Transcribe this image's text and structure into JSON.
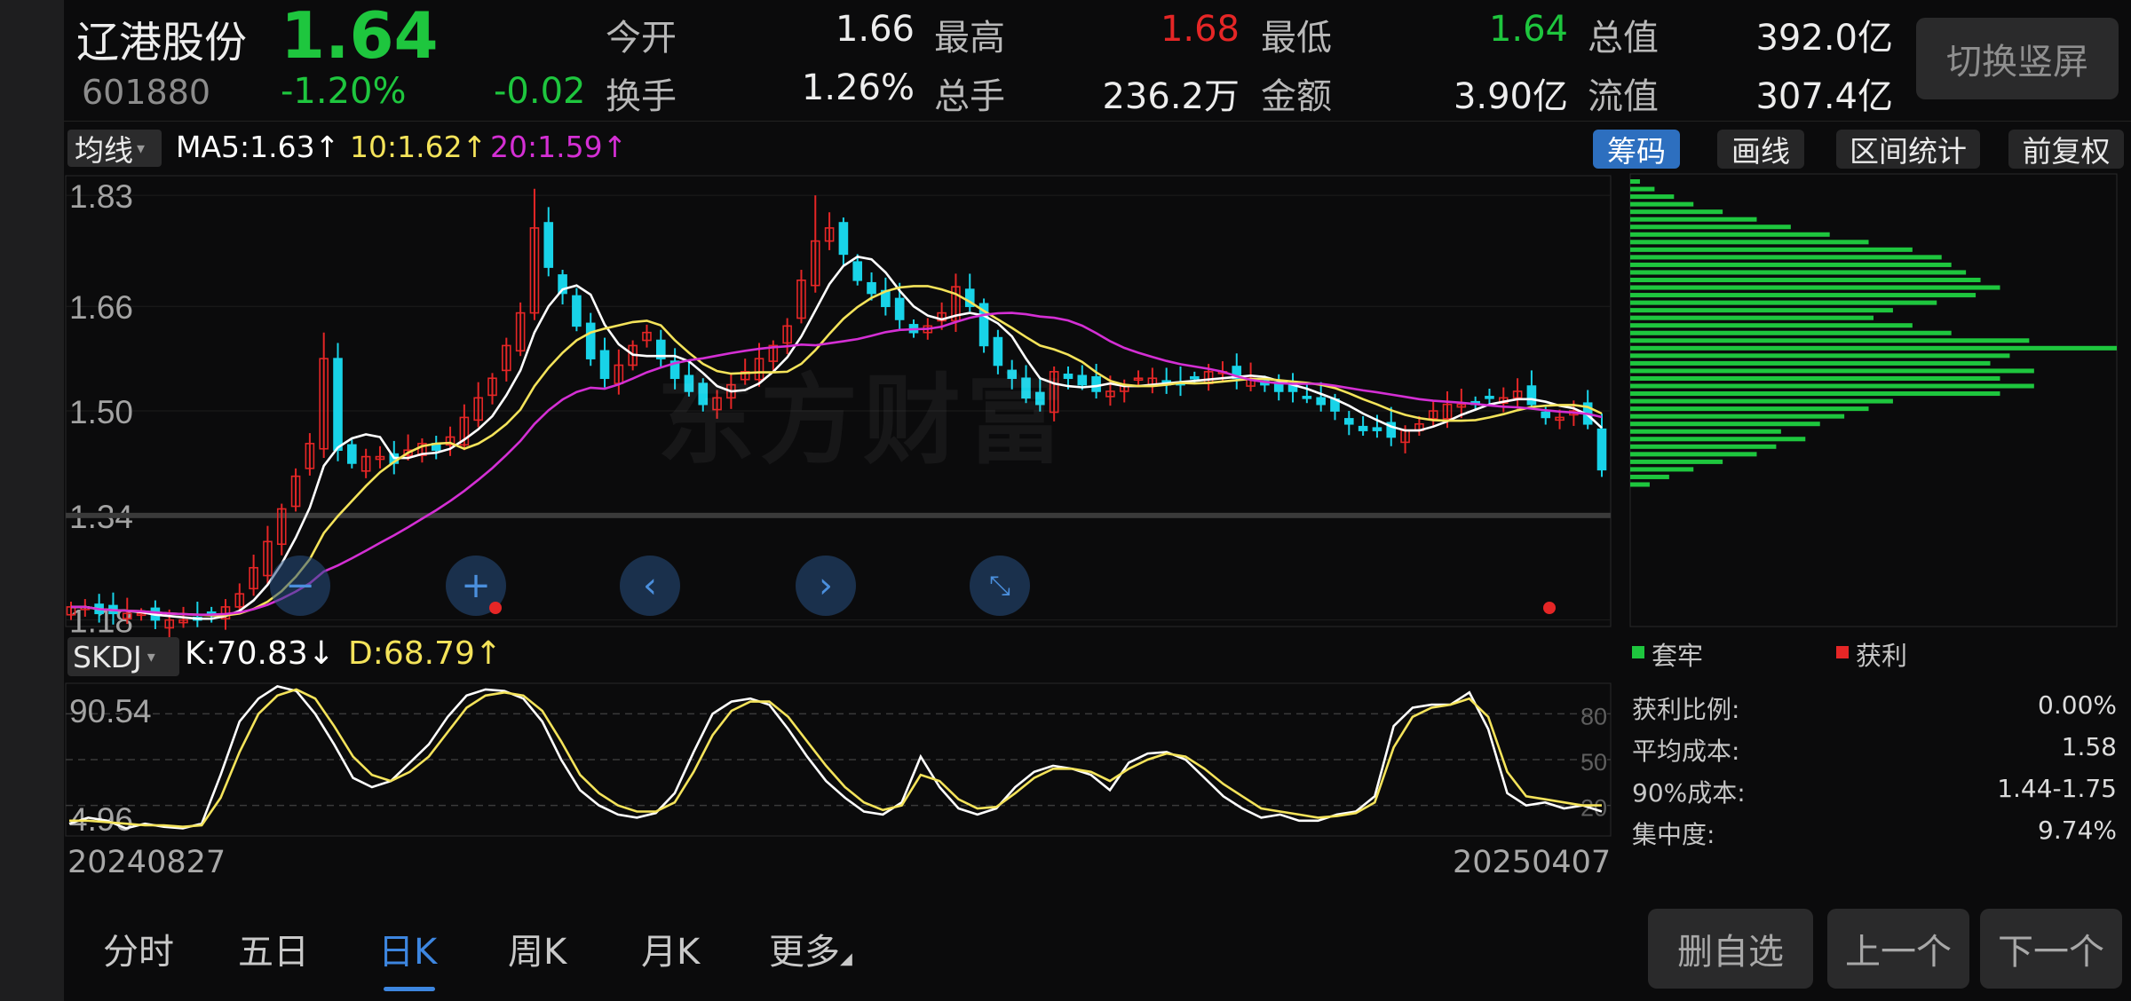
{
  "header": {
    "stock_name": "辽港股份",
    "price": "1.64",
    "code": "601880",
    "change_pct": "-1.20%",
    "change": "-0.02",
    "switch_label": "切换竖屏",
    "quotes": [
      {
        "label": "今开",
        "value": "1.66",
        "color": "#ededed"
      },
      {
        "label": "最高",
        "value": "1.68",
        "color": "#e52626"
      },
      {
        "label": "最低",
        "value": "1.64",
        "color": "#1ec63e"
      },
      {
        "label": "总值",
        "value": "392.0亿",
        "color": "#ededed"
      },
      {
        "label": "换手",
        "value": "1.26%",
        "color": "#ededed"
      },
      {
        "label": "总手",
        "value": "236.2万",
        "color": "#ededed"
      },
      {
        "label": "金额",
        "value": "3.90亿",
        "color": "#ededed"
      },
      {
        "label": "流值",
        "value": "307.4亿",
        "color": "#ededed"
      }
    ]
  },
  "toolbar": {
    "ma_selector": "均线",
    "ma5": "MA5:1.63↑",
    "ma10": "10:1.62↑",
    "ma20": "20:1.59↑",
    "buttons": [
      "筹码",
      "画线",
      "区间统计",
      "前复权"
    ]
  },
  "colors": {
    "up": "#e52626",
    "down": "#18d3e8",
    "ma5": "#ffffff",
    "ma10": "#f4e35a",
    "ma20": "#d42fd4",
    "chip": "#1ec63e",
    "kline": "#ffffff",
    "dline": "#f4e35a"
  },
  "watermark": "东方财富",
  "indicator": {
    "selector": "SKDJ",
    "k": "K:70.83↓",
    "d": "D:68.79↑"
  },
  "dates": {
    "start": "20240827",
    "end": "20250407"
  },
  "chips": {
    "legend_loss": "套牢",
    "legend_profit": "获利",
    "stats": [
      {
        "label": "获利比例:",
        "value": "0.00%"
      },
      {
        "label": "平均成本:",
        "value": "1.58"
      },
      {
        "label": "90%成本:",
        "value": "1.44-1.75"
      },
      {
        "label": "集中度:",
        "value": "9.74%"
      }
    ]
  },
  "tabs": [
    "分时",
    "五日",
    "日K",
    "周K",
    "月K",
    "更多"
  ],
  "active_tab": "日K",
  "bottom_buttons": [
    "删自选",
    "上一个",
    "下一个"
  ],
  "chart_data": [
    {
      "type": "candlestick",
      "y_ticks": [
        "1.83",
        "1.66",
        "1.50",
        "1.34",
        "1.18"
      ],
      "ylim": [
        1.17,
        1.86
      ],
      "x_range": [
        "20240827",
        "20250407"
      ],
      "series_ma": [
        {
          "name": "MA5",
          "last": 1.63
        },
        {
          "name": "MA10",
          "last": 1.62
        },
        {
          "name": "MA20",
          "last": 1.59
        }
      ],
      "close_path": [
        1.2,
        1.2,
        1.19,
        1.19,
        1.19,
        1.19,
        1.18,
        1.18,
        1.18,
        1.18,
        1.19,
        1.2,
        1.22,
        1.26,
        1.3,
        1.35,
        1.4,
        1.45,
        1.58,
        1.44,
        1.42,
        1.43,
        1.43,
        1.42,
        1.44,
        1.45,
        1.44,
        1.46,
        1.49,
        1.52,
        1.55,
        1.6,
        1.65,
        1.78,
        1.72,
        1.68,
        1.63,
        1.58,
        1.55,
        1.57,
        1.6,
        1.62,
        1.58,
        1.55,
        1.53,
        1.51,
        1.52,
        1.54,
        1.56,
        1.58,
        1.6,
        1.63,
        1.7,
        1.76,
        1.78,
        1.74,
        1.7,
        1.68,
        1.66,
        1.64,
        1.62,
        1.63,
        1.65,
        1.69,
        1.66,
        1.6,
        1.57,
        1.55,
        1.52,
        1.51,
        1.56,
        1.55,
        1.54,
        1.53,
        1.53,
        1.54,
        1.55,
        1.55,
        1.54,
        1.54,
        1.55,
        1.56,
        1.56,
        1.55,
        1.55,
        1.54,
        1.53,
        1.53,
        1.52,
        1.51,
        1.5,
        1.48,
        1.47,
        1.47,
        1.46,
        1.47,
        1.48,
        1.5,
        1.51,
        1.51,
        1.51,
        1.52,
        1.52,
        1.53,
        1.51,
        1.49,
        1.49,
        1.5,
        1.48,
        1.41
      ]
    },
    {
      "type": "line",
      "title": "SKDJ",
      "y_ticks": [
        "90.54",
        "4.96"
      ],
      "right_ticks": [
        "80",
        "50",
        "20"
      ],
      "ylim": [
        0,
        100
      ],
      "series": [
        {
          "name": "K",
          "values": [
            8,
            12,
            10,
            5,
            8,
            6,
            5,
            8,
            40,
            75,
            90,
            98,
            95,
            80,
            60,
            38,
            32,
            36,
            48,
            60,
            78,
            92,
            96,
            95,
            90,
            75,
            50,
            30,
            20,
            14,
            12,
            15,
            28,
            55,
            80,
            88,
            90,
            86,
            70,
            52,
            36,
            25,
            16,
            14,
            22,
            52,
            32,
            18,
            14,
            18,
            32,
            42,
            46,
            44,
            40,
            30,
            48,
            54,
            55,
            50,
            38,
            26,
            18,
            12,
            14,
            10,
            10,
            14,
            16,
            26,
            72,
            84,
            86,
            86,
            94,
            70,
            28,
            20,
            22,
            18,
            20,
            16
          ]
        },
        {
          "name": "D",
          "values": [
            10,
            10,
            9,
            8,
            7,
            7,
            6,
            7,
            25,
            55,
            80,
            92,
            96,
            90,
            72,
            52,
            40,
            36,
            42,
            52,
            68,
            84,
            92,
            94,
            92,
            82,
            62,
            40,
            28,
            20,
            16,
            16,
            22,
            42,
            66,
            82,
            88,
            88,
            78,
            62,
            46,
            32,
            22,
            17,
            20,
            40,
            36,
            24,
            18,
            19,
            28,
            38,
            44,
            44,
            42,
            36,
            44,
            50,
            54,
            52,
            44,
            34,
            26,
            18,
            16,
            14,
            12,
            13,
            15,
            22,
            58,
            78,
            84,
            86,
            90,
            78,
            42,
            26,
            24,
            22,
            20,
            20
          ]
        }
      ],
      "current": {
        "K": 70.83,
        "D": 68.79
      }
    },
    {
      "type": "bar",
      "title": "筹码分布",
      "orientation": "horizontal",
      "note": "chip distribution by price level, relative length 0-1",
      "values": [
        0.02,
        0.05,
        0.09,
        0.13,
        0.19,
        0.26,
        0.33,
        0.41,
        0.49,
        0.58,
        0.64,
        0.66,
        0.69,
        0.72,
        0.76,
        0.71,
        0.63,
        0.54,
        0.5,
        0.58,
        0.66,
        0.82,
        1.0,
        0.78,
        0.74,
        0.83,
        0.76,
        0.83,
        0.76,
        0.54,
        0.49,
        0.44,
        0.39,
        0.31,
        0.36,
        0.3,
        0.26,
        0.19,
        0.13,
        0.08,
        0.04
      ]
    }
  ]
}
